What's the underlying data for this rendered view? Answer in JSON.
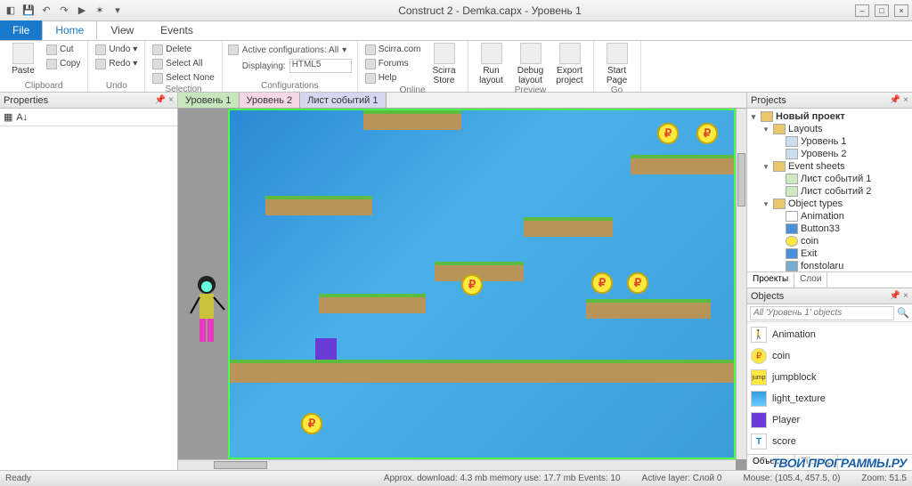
{
  "window_title": "Construct 2 - Demka.capx - Уровень 1",
  "ribbon": {
    "file": "File",
    "tabs": [
      "Home",
      "View",
      "Events"
    ],
    "active": 0,
    "clipboard": {
      "paste": "Paste",
      "cut": "Cut",
      "copy": "Copy",
      "label": "Clipboard"
    },
    "undo": {
      "undo": "Undo",
      "redo": "Redo",
      "label": "Undo"
    },
    "selection": {
      "delete": "Delete",
      "select_all": "Select All",
      "select_none": "Select None",
      "label": "Selection"
    },
    "configs": {
      "active_cfg": "Active configurations: All",
      "displaying": "Displaying:",
      "display_val": "HTML5",
      "label": "Configurations"
    },
    "online": {
      "scirra": "Scirra.com",
      "forums": "Forums",
      "help": "Help",
      "store": "Scirra\nStore",
      "label": "Online"
    },
    "preview": {
      "run": "Run\nlayout",
      "debug": "Debug\nlayout",
      "export": "Export\nproject",
      "label": "Preview"
    },
    "go": {
      "start": "Start\nPage",
      "label": "Go"
    }
  },
  "properties": {
    "title": "Properties"
  },
  "doc_tabs": [
    "Уровень 1",
    "Уровень 2",
    "Лист событий 1"
  ],
  "projects": {
    "title": "Projects",
    "root": "Новый проект",
    "layouts": "Layouts",
    "layout_items": [
      "Уровень 1",
      "Уровень 2"
    ],
    "event_sheets": "Event sheets",
    "event_items": [
      "Лист событий 1",
      "Лист событий 2"
    ],
    "object_types": "Object types",
    "ot_items": [
      "Animation",
      "Button33",
      "coin",
      "Exit",
      "fonstolaru"
    ],
    "subtabs": [
      "Проекты",
      "Слои"
    ]
  },
  "objects": {
    "title": "Objects",
    "search_placeholder": "All 'Уровень 1' objects",
    "items": [
      "Animation",
      "coin",
      "jumpblock",
      "light_texture",
      "Player",
      "score"
    ],
    "subtabs": [
      "Объекты",
      "Tilemap"
    ]
  },
  "status": {
    "ready": "Ready",
    "mem": "Approx. download: 4.3 mb   memory use: 17.7 mb   Events: 10",
    "layer": "Active layer: Слой 0",
    "mouse": "Mouse: (105.4, 457.5, 0)",
    "zoom": "Zoom: 51.5"
  },
  "watermark": "ТВОИ ПРОГРАММЫ.РУ"
}
